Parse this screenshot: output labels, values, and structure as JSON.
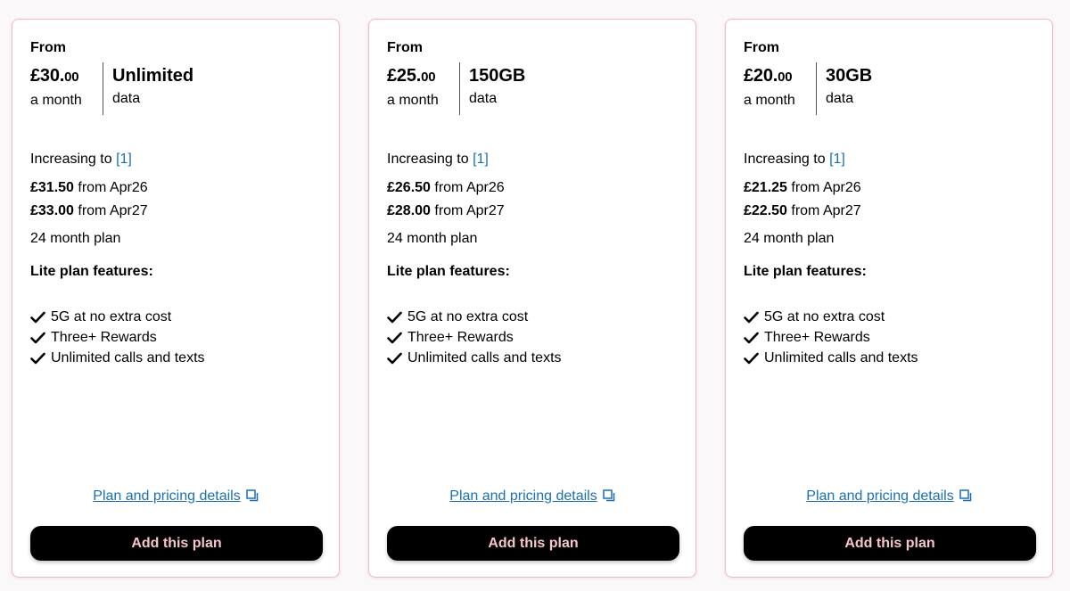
{
  "plans": [
    {
      "from_label": "From",
      "price_pounds": "£30.",
      "price_pence": "00",
      "per": "a month",
      "data_amount": "Unlimited",
      "data_label": "data",
      "increasing_label": "Increasing to",
      "ref": "[1]",
      "increase_1_price": "£31.50",
      "increase_1_date": " from Apr26",
      "increase_2_price": "£33.00",
      "increase_2_date": " from Apr27",
      "term": "24 month plan",
      "features_title": "Lite plan features:",
      "features": [
        "5G at no extra cost",
        "Three+ Rewards",
        "Unlimited calls and texts"
      ],
      "details_link": "Plan and pricing details",
      "button": "Add this plan"
    },
    {
      "from_label": "From",
      "price_pounds": "£25.",
      "price_pence": "00",
      "per": "a month",
      "data_amount": "150GB",
      "data_label": "data",
      "increasing_label": "Increasing to",
      "ref": "[1]",
      "increase_1_price": "£26.50",
      "increase_1_date": " from Apr26",
      "increase_2_price": "£28.00",
      "increase_2_date": " from Apr27",
      "term": "24 month plan",
      "features_title": "Lite plan features:",
      "features": [
        "5G at no extra cost",
        "Three+ Rewards",
        "Unlimited calls and texts"
      ],
      "details_link": "Plan and pricing details",
      "button": "Add this plan"
    },
    {
      "from_label": "From",
      "price_pounds": "£20.",
      "price_pence": "00",
      "per": "a month",
      "data_amount": "30GB",
      "data_label": "data",
      "increasing_label": "Increasing to",
      "ref": "[1]",
      "increase_1_price": "£21.25",
      "increase_1_date": " from Apr26",
      "increase_2_price": "£22.50",
      "increase_2_date": " from Apr27",
      "term": "24 month plan",
      "features_title": "Lite plan features:",
      "features": [
        "5G at no extra cost",
        "Three+ Rewards",
        "Unlimited calls and texts"
      ],
      "details_link": "Plan and pricing details",
      "button": "Add this plan"
    }
  ],
  "icons": {
    "check": "check-icon",
    "external": "external-link-icon"
  },
  "colors": {
    "button_bg": "#000000",
    "button_text": "#f7c5cc",
    "link": "#1a6fb5",
    "card_border": "#f3b9c3"
  }
}
